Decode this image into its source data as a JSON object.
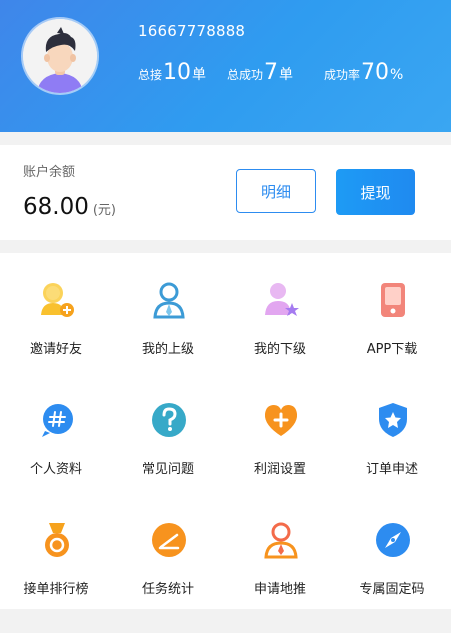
{
  "profile": {
    "phone": "16667778888",
    "stats": [
      {
        "label": "总接",
        "value": "10",
        "unit": "单"
      },
      {
        "label": "总成功",
        "value": "7",
        "unit": "单"
      },
      {
        "label": "成功率",
        "value": "70",
        "unit": "%"
      }
    ]
  },
  "balance": {
    "label": "账户余额",
    "amount": "68.00",
    "unit": "(元)",
    "detail_button": "明细",
    "withdraw_button": "提现"
  },
  "menu": {
    "items": [
      {
        "label": "邀请好友",
        "icon": "invite-friend-icon"
      },
      {
        "label": "我的上级",
        "icon": "superior-icon"
      },
      {
        "label": "我的下级",
        "icon": "subordinate-icon"
      },
      {
        "label": "APP下载",
        "icon": "phone-download-icon"
      },
      {
        "label": "个人资料",
        "icon": "profile-hash-icon"
      },
      {
        "label": "常见问题",
        "icon": "question-icon"
      },
      {
        "label": "利润设置",
        "icon": "heart-plus-icon"
      },
      {
        "label": "订单申述",
        "icon": "shield-star-icon"
      },
      {
        "label": "接单排行榜",
        "icon": "medal-icon"
      },
      {
        "label": "任务统计",
        "icon": "chart-icon"
      },
      {
        "label": "申请地推",
        "icon": "person-tie-icon"
      },
      {
        "label": "专属固定码",
        "icon": "compass-icon"
      }
    ]
  },
  "colors": {
    "header_start": "#3f86ea",
    "header_end": "#3aa6f2",
    "primary": "#2d8cf0"
  }
}
